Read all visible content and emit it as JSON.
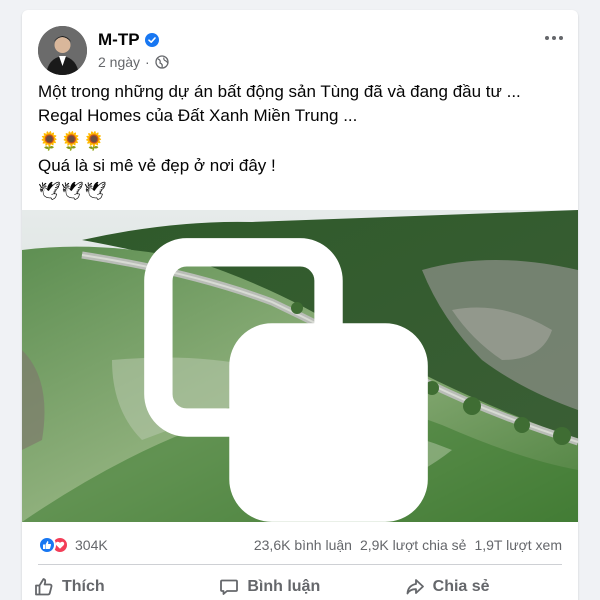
{
  "post": {
    "author": "M-TP",
    "verified": true,
    "time": "2 ngày",
    "privacy_icon": "globe-icon",
    "text_lines": [
      "Một trong những dự án bất động sản Tùng đã và đang đầu tư ...",
      "Regal Homes của Đất Xanh Miền Trung ..."
    ],
    "emoji_line_1": "🌻🌻🌻",
    "text_line_3": "Quá là si mê vẻ đẹp ở nơi đây !",
    "emoji_line_2": "🕊🕊🕊"
  },
  "stats": {
    "reactions": "304K",
    "comments": "23,6K bình luận",
    "shares": "2,9K lượt chia sẻ",
    "views": "1,9T lượt xem"
  },
  "actions": {
    "like": "Thích",
    "comment": "Bình luận",
    "share": "Chia sẻ"
  },
  "colors": {
    "accent": "#1877f2",
    "love": "#f33e58",
    "muted_text": "#65676b"
  }
}
